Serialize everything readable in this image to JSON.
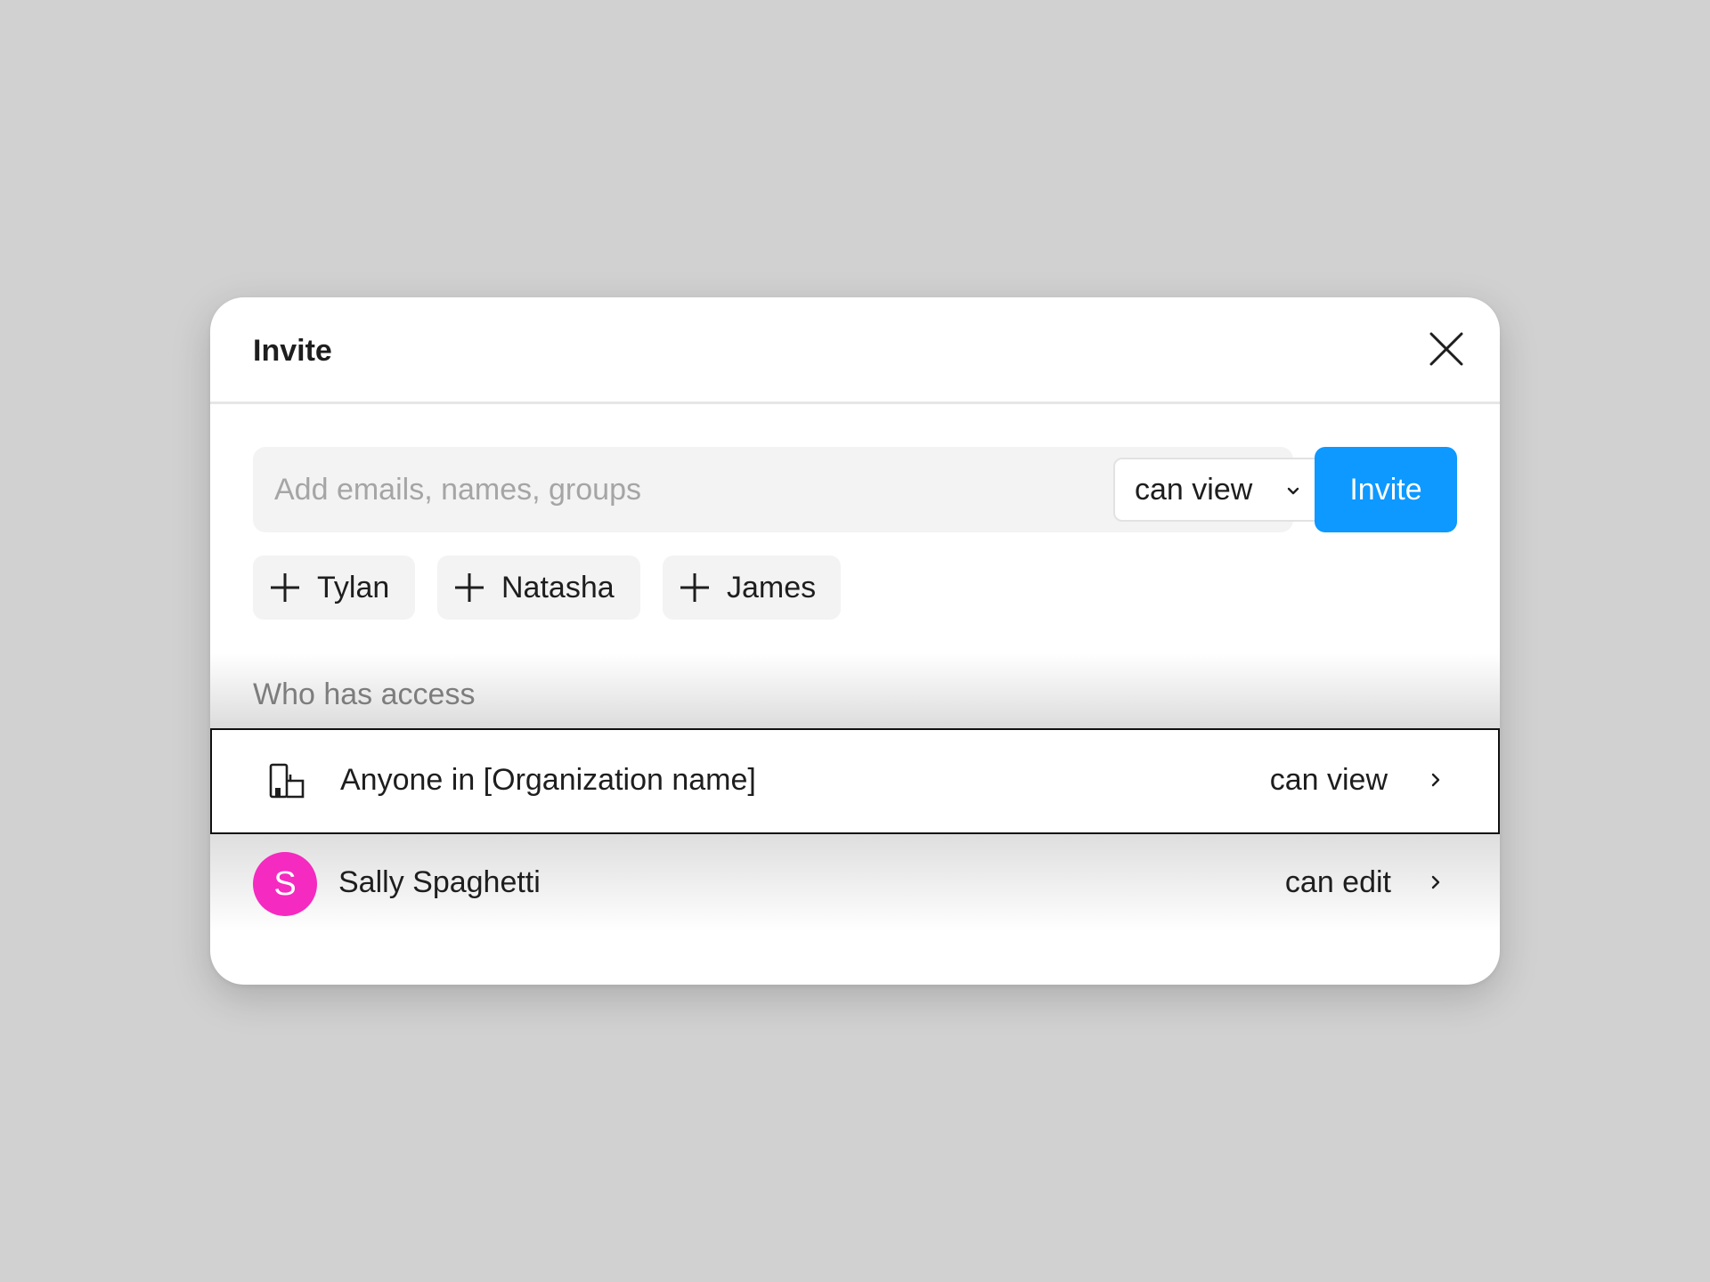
{
  "dialog": {
    "title": "Invite",
    "close_icon": "close-icon"
  },
  "invite": {
    "placeholder": "Add emails, names, groups",
    "value": "",
    "role": "can view",
    "button_label": "Invite"
  },
  "suggestions": [
    {
      "label": "Tylan",
      "icon": "plus-icon"
    },
    {
      "label": "Natasha",
      "icon": "plus-icon"
    },
    {
      "label": "James",
      "icon": "plus-icon"
    }
  ],
  "access": {
    "heading": "Who has access",
    "rows": [
      {
        "name": "Anyone in [Organization name]",
        "role": "can view",
        "icon": "organization-icon"
      },
      {
        "name": "Sally Spaghetti",
        "role": "can edit",
        "avatar_initial": "S",
        "avatar_color": "#f52ac0"
      }
    ]
  },
  "colors": {
    "accent": "#0d99ff",
    "background": "#d1d1d1",
    "avatar": "#f52ac0"
  }
}
